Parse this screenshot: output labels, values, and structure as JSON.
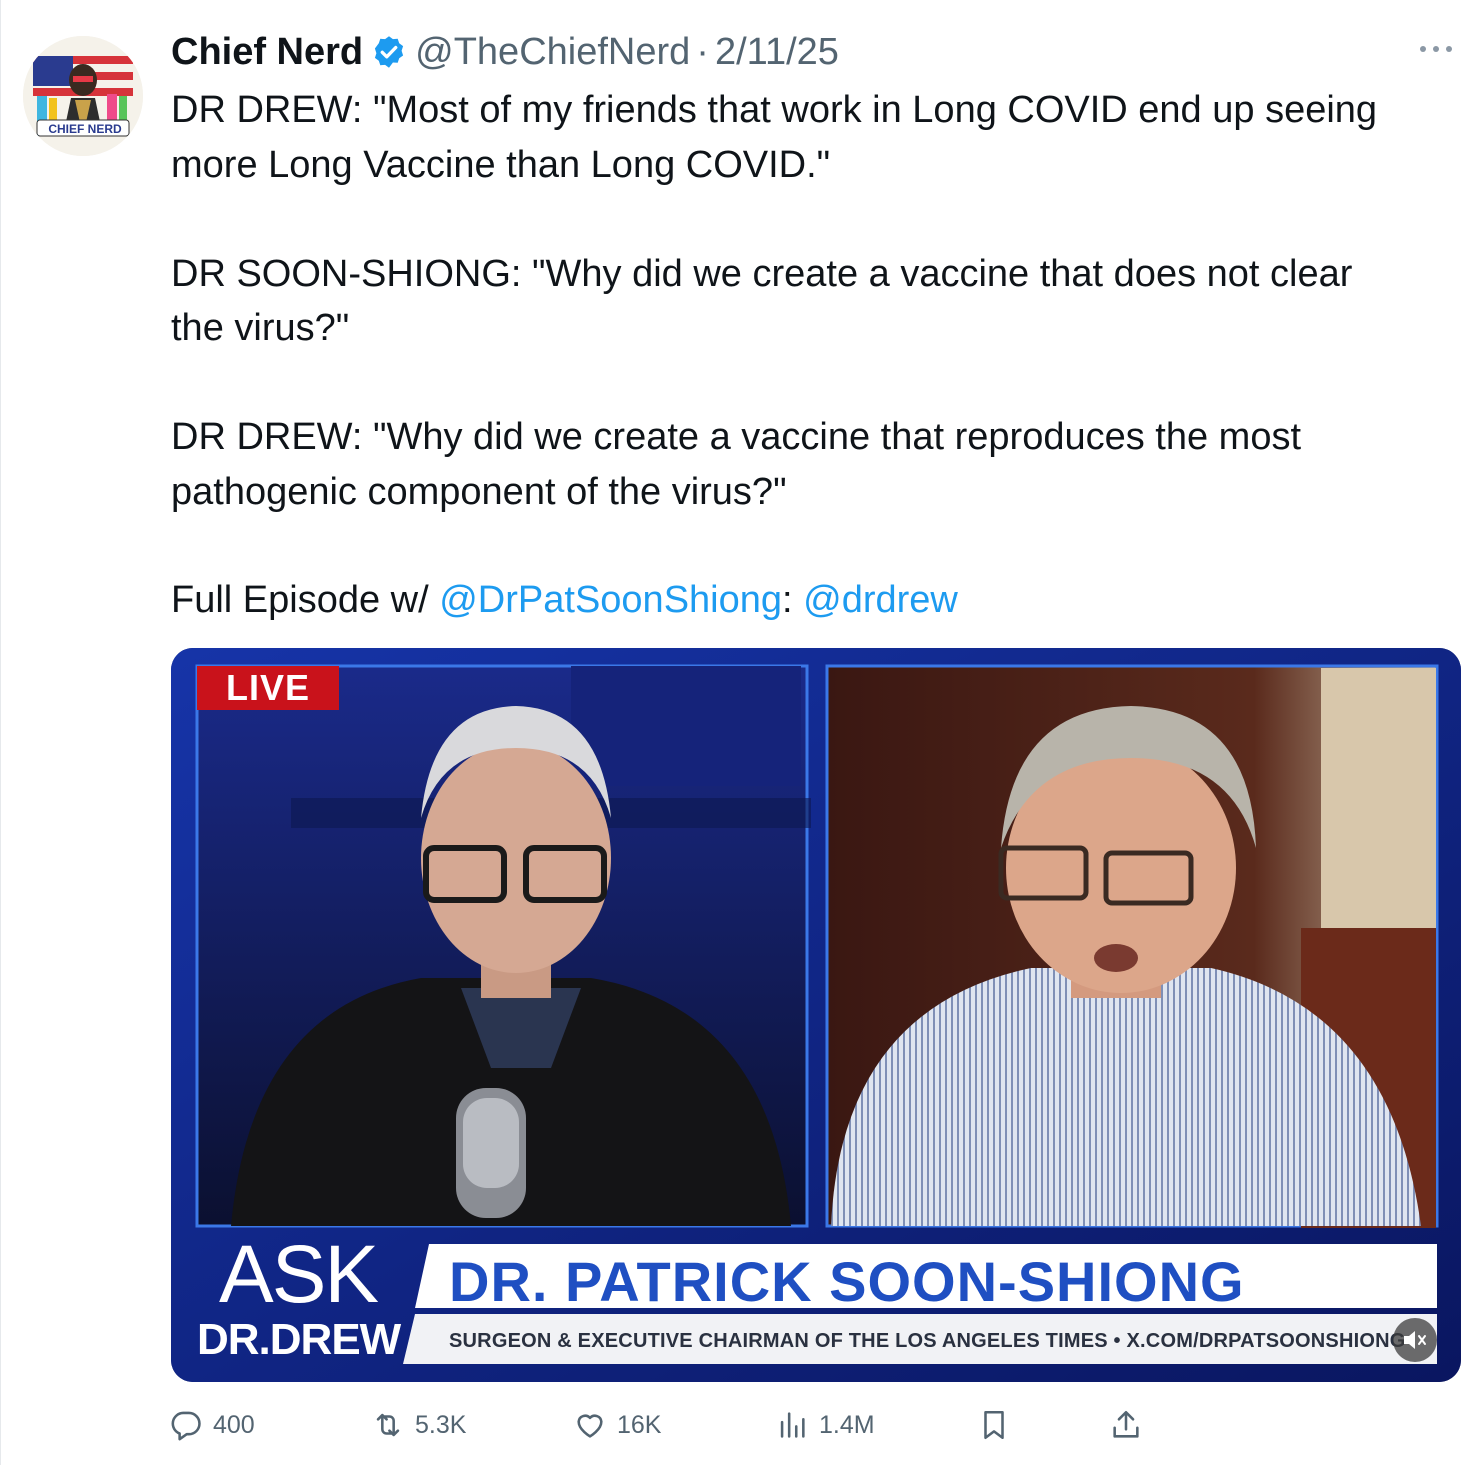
{
  "tweet": {
    "author_name": "Chief Nerd",
    "handle": "@TheChiefNerd",
    "separator": "·",
    "date": "2/11/25",
    "avatar_label": "CHIEF NERD",
    "text": {
      "p1_line1": "DR DREW: \"Most of my friends that work in Long COVID end up seeing",
      "p1_line2": "more Long Vaccine than Long COVID.\"",
      "p2_line1": "DR SOON-SHIONG: \"Why did we create a vaccine that does not clear",
      "p2_line2": "the virus?\"",
      "p3_line1": "DR DREW: \"Why did we create a vaccine that reproduces the most",
      "p3_line2": "pathogenic component of the virus?\"",
      "p4_prefix": "Full Episode w/ ",
      "p4_mention1": "@DrPatSoonShiong",
      "p4_colon": ": ",
      "p4_mention2": "@drdrew"
    }
  },
  "video": {
    "live_badge": "LIVE",
    "show_ask": "ASK",
    "show_drdrew": "DR.DREW",
    "guest_name": "DR. PATRICK SOON-SHIONG",
    "guest_subtitle": "SURGEON & EXECUTIVE CHAIRMAN OF THE LOS ANGELES TIMES  •  X.COM/DRPATSOONSHIONG"
  },
  "actions": {
    "replies": "400",
    "reposts": "5.3K",
    "likes": "16K",
    "views": "1.4M"
  },
  "colors": {
    "link": "#1d9bf0",
    "verified": "#1d9bf0",
    "secondary_text": "#536471",
    "primary_text": "#0f1419"
  },
  "icons": [
    "verified-badge-icon",
    "more-icon",
    "reply-icon",
    "repost-icon",
    "like-icon",
    "views-icon",
    "bookmark-icon",
    "share-icon",
    "mute-icon"
  ]
}
